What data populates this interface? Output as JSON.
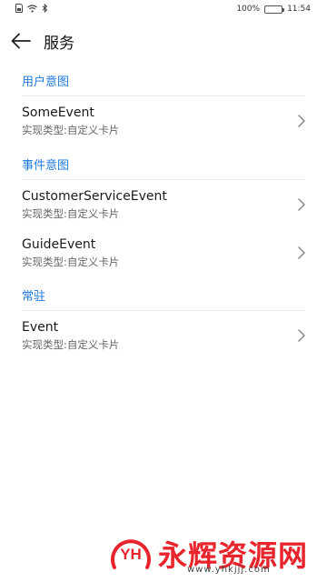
{
  "status_bar": {
    "battery_text": "100%",
    "battery_level": 1.0,
    "time": "11:54"
  },
  "header": {
    "back_icon": "arrow-left-icon",
    "title": "服务"
  },
  "sections": [
    {
      "title": "用户意图",
      "items": [
        {
          "name": "SomeEvent",
          "subtitle": "实现类型:自定义卡片"
        }
      ]
    },
    {
      "title": "事件意图",
      "items": [
        {
          "name": "CustomerServiceEvent",
          "subtitle": "实现类型:自定义卡片"
        },
        {
          "name": "GuideEvent",
          "subtitle": "实现类型:自定义卡片"
        }
      ]
    },
    {
      "title": "常驻",
      "items": [
        {
          "name": "Event",
          "subtitle": "实现类型:自定义卡片"
        }
      ]
    }
  ],
  "watermark": {
    "logo": "YH",
    "text": "永辉资源网",
    "url": "www.yhkjjj.com"
  },
  "colors": {
    "accent": "#1f7ae0",
    "watermark": "#e8242c"
  }
}
